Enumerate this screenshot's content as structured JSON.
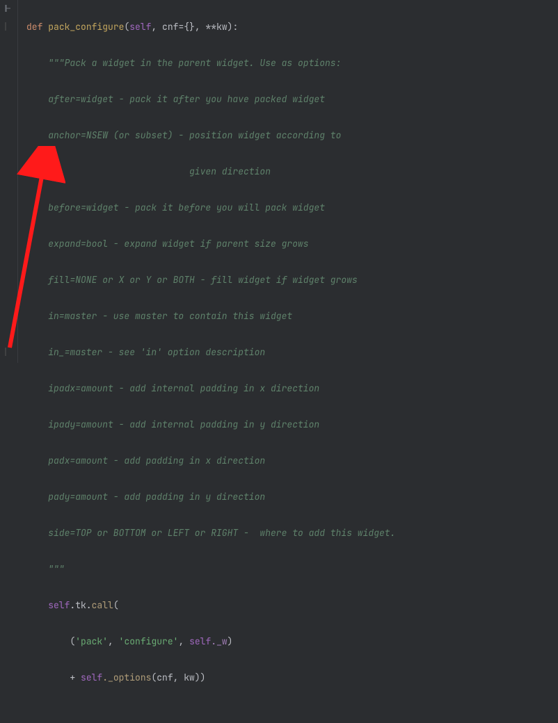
{
  "signature": {
    "def": "def",
    "name": "pack_configure",
    "self": "self",
    "p1": "cnf",
    "p1_default": "={}",
    "p2_prefix": ", **",
    "p2": "kw",
    "close": "):"
  },
  "docstring": {
    "open": "\"\"\"Pack a widget in the parent widget. Use as options:",
    "l1": "after=widget - pack it after you have packed widget",
    "l2": "anchor=NSEW (or subset) - position widget according to",
    "l2b": "                          given direction",
    "l3": "before=widget - pack it before you will pack widget",
    "l4": "expand=bool - expand widget if parent size grows",
    "l5": "fill=NONE or X or Y or BOTH - fill widget if widget grows",
    "l6": "in=master - use master to contain this widget",
    "l7": "in_=master - see 'in' option description",
    "l8": "ipadx=amount - add internal padding in x direction",
    "l9": "ipady=amount - add internal padding in y direction",
    "l10": "padx=amount - add padding in x direction",
    "l11": "pady=amount - add padding in y direction",
    "l12": "side=TOP or BOTTOM or LEFT or RIGHT -  where to add this widget.",
    "close": "\"\"\""
  },
  "body": {
    "call_self": "self",
    "call_tk": ".tk.",
    "call_name": "call",
    "tuple_open": "(",
    "s_pack": "'pack'",
    "comma": ", ",
    "s_configure": "'configure'",
    "self2": "self",
    "w_attr": "._w",
    "tuple_close": ")",
    "plus": "+ ",
    "self3": "self",
    "opts": "._options",
    "args_open": "(",
    "a1": "cnf",
    "a2": "kw",
    "args_close": "))"
  }
}
